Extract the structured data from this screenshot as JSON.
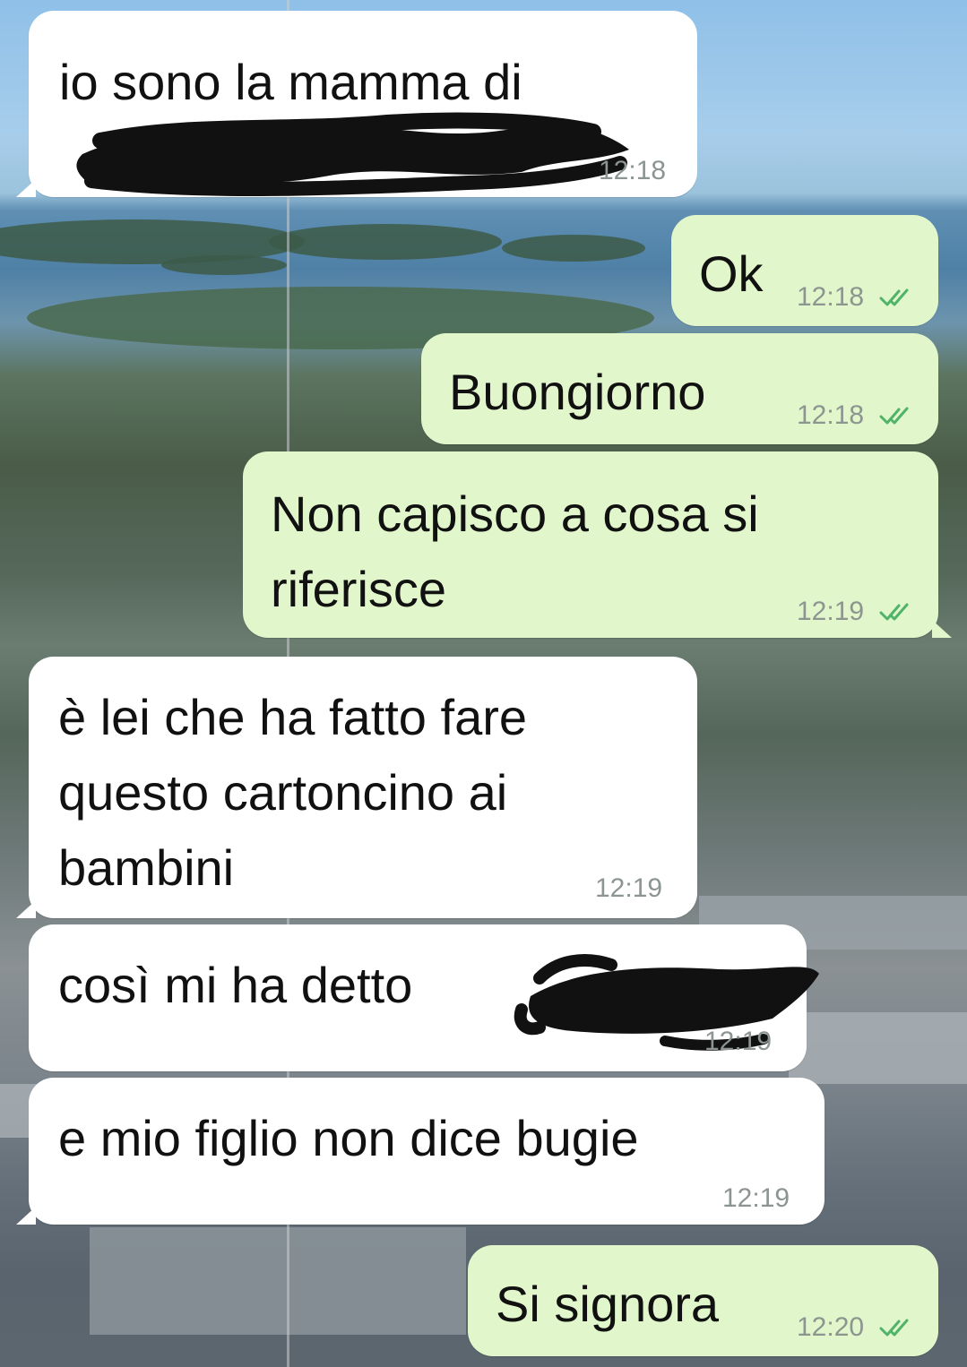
{
  "messages": [
    {
      "direction": "incoming",
      "text": "io sono la mamma di",
      "time": "12:18",
      "redacted": true
    },
    {
      "direction": "outgoing",
      "text": "Ok",
      "time": "12:18",
      "status": "read-icon"
    },
    {
      "direction": "outgoing",
      "text": "Buongiorno",
      "time": "12:18",
      "status": "read-icon"
    },
    {
      "direction": "outgoing",
      "text": "Non capisco a cosa si\nriferisce",
      "time": "12:19",
      "status": "read-icon"
    },
    {
      "direction": "incoming",
      "text": "è lei che ha fatto fare\nquesto cartoncino ai\nbambini",
      "time": "12:19"
    },
    {
      "direction": "incoming",
      "text": "così mi ha detto",
      "time": "12:19",
      "redacted": true
    },
    {
      "direction": "incoming",
      "text": "e mio figlio non dice bugie",
      "time": "12:19"
    },
    {
      "direction": "outgoing",
      "text": "Si signora",
      "time": "12:20",
      "status": "read-icon"
    }
  ],
  "colors": {
    "incoming_bubble": "#ffffff",
    "outgoing_bubble": "#e1f7cb",
    "read_ticks": "#4fb368",
    "timestamp": "#8c9590"
  }
}
